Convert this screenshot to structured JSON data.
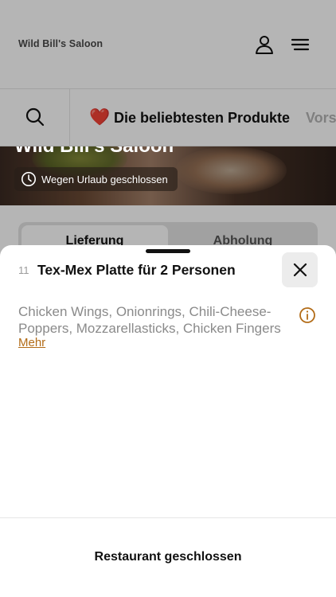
{
  "header": {
    "brand": "Wild Bill's Saloon"
  },
  "category_bar": {
    "heart_emoji": "❤️",
    "active_label": "Die beliebtesten Produkte",
    "next_label": "Vors"
  },
  "hero": {
    "title": "Wild Bill's Saloon",
    "status_text": "Wegen Urlaub geschlossen"
  },
  "mode_toggle": {
    "left_label": "Lieferung",
    "right_label": "Abholung"
  },
  "product_sheet": {
    "item_number": "11",
    "item_name": "Tex-Mex Platte für 2 Personen",
    "description": "Chicken Wings, Onionrings, Chili-Cheese-Poppers, Mozzarellasticks, Chicken Fingers",
    "more_label": "Mehr",
    "footer_status": "Restaurant geschlossen"
  },
  "colors": {
    "accent": "#b26b16",
    "heart": "#d81e2a"
  },
  "icons": {
    "user": "user-icon",
    "menu": "hamburger-menu-icon",
    "search": "search-icon",
    "clock": "clock-icon",
    "close": "close-icon",
    "info": "info-icon"
  }
}
